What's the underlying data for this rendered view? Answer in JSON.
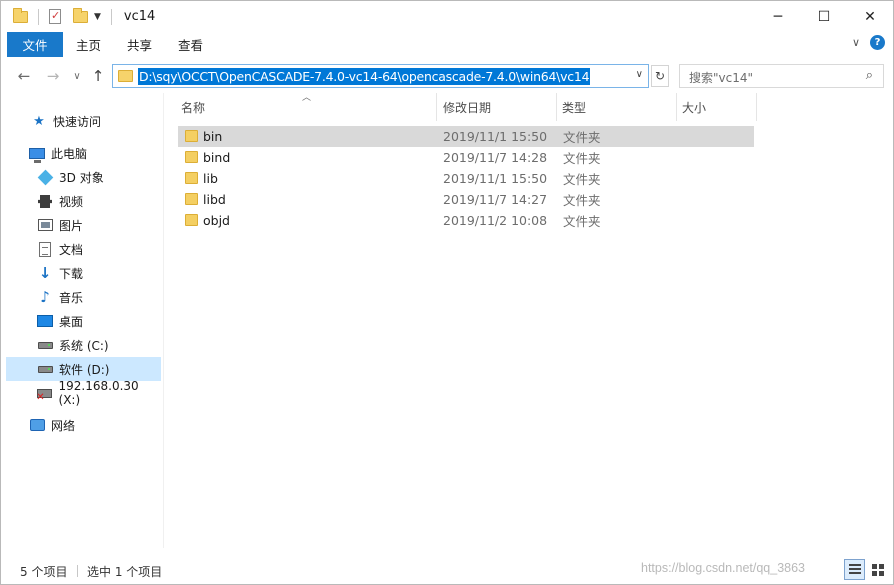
{
  "window": {
    "title": "vc14",
    "controls": {
      "minimize": "─",
      "maximize": "☐",
      "close": "✕"
    }
  },
  "ribbon": {
    "tabs": [
      "文件",
      "主页",
      "共享",
      "查看"
    ],
    "collapse": "∨",
    "help": "?"
  },
  "nav": {
    "back": "←",
    "forward": "→",
    "recent": "∨",
    "up": "↑",
    "address": "D:\\sqy\\OCCT\\OpenCASCADE-7.4.0-vc14-64\\opencascade-7.4.0\\win64\\vc14",
    "address_drop": "∨",
    "refresh": "↻",
    "search_placeholder": "搜索\"vc14\"",
    "search_icon": "⌕"
  },
  "sidebar": {
    "items": [
      {
        "label": "快速访问",
        "icon": "star-icon"
      },
      {
        "label": "此电脑",
        "icon": "computer-icon"
      },
      {
        "label": "3D 对象",
        "icon": "cube-icon"
      },
      {
        "label": "视频",
        "icon": "video-icon"
      },
      {
        "label": "图片",
        "icon": "picture-icon"
      },
      {
        "label": "文档",
        "icon": "document-icon"
      },
      {
        "label": "下载",
        "icon": "download-icon"
      },
      {
        "label": "音乐",
        "icon": "music-icon"
      },
      {
        "label": "桌面",
        "icon": "desktop-icon"
      },
      {
        "label": "系统 (C:)",
        "icon": "drive-icon"
      },
      {
        "label": "软件 (D:)",
        "icon": "drive-icon"
      },
      {
        "label": "192.168.0.30 (X:)",
        "icon": "network-drive-icon"
      },
      {
        "label": "网络",
        "icon": "network-icon"
      }
    ],
    "selected": "软件 (D:)"
  },
  "columns": {
    "name": "名称",
    "date": "修改日期",
    "type": "类型",
    "size": "大小"
  },
  "files": [
    {
      "name": "bin",
      "date": "2019/11/1 15:50",
      "type": "文件夹",
      "selected": true
    },
    {
      "name": "bind",
      "date": "2019/11/7 14:28",
      "type": "文件夹"
    },
    {
      "name": "lib",
      "date": "2019/11/1 15:50",
      "type": "文件夹"
    },
    {
      "name": "libd",
      "date": "2019/11/7 14:27",
      "type": "文件夹"
    },
    {
      "name": "objd",
      "date": "2019/11/2 10:08",
      "type": "文件夹"
    }
  ],
  "status": {
    "count": "5 个项目",
    "selection": "选中 1 个项目"
  },
  "watermark": "https://blog.csdn.net/qq_3863"
}
